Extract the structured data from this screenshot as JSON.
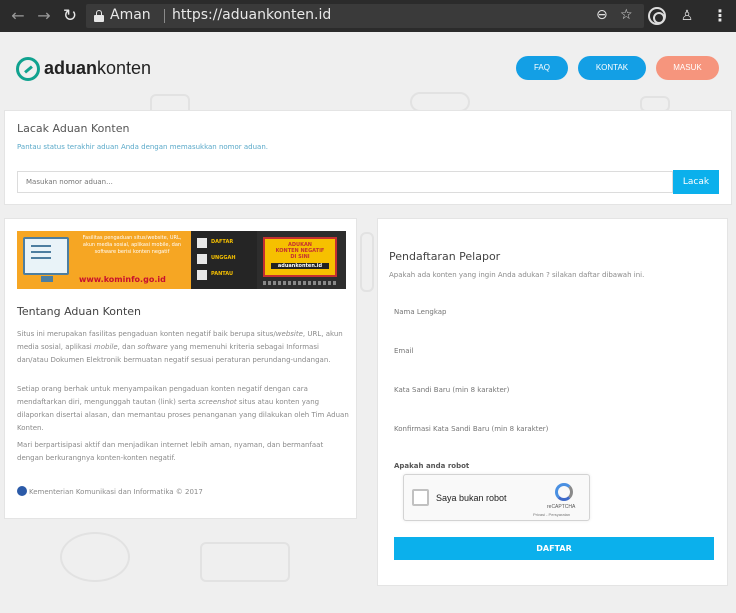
{
  "browser": {
    "secure_label": "Aman",
    "url": "https://aduankonten.id"
  },
  "logo": {
    "part1": "aduan",
    "part2": "konten"
  },
  "nav": {
    "faq": "FAQ",
    "kontak": "KONTAK",
    "masuk": "MASUK"
  },
  "lacak": {
    "title": "Lacak Aduan Konten",
    "subtitle": "Pantau status terakhir aduan Anda dengan memasukkan nomor aduan.",
    "placeholder": "Masukan nomor aduan...",
    "button": "Lacak"
  },
  "banner": {
    "facility": "Fasilitas pengaduan situs/website, URL, akun media sosial, aplikasi mobile, dan software berisi konten negatif",
    "url": "www.kominfo.go.id",
    "steps": [
      "DAFTAR",
      "UNGGAH",
      "PANTAU"
    ],
    "cta_line1": "ADUKAN",
    "cta_line2": "KONTEN NEGATIF",
    "cta_line3": "DI SINI",
    "cta_url": "aduankonten.id"
  },
  "tentang": {
    "title": "Tentang Aduan Konten",
    "p1_a": "Situs ini merupakan fasilitas pengaduan konten negatif baik berupa situs/",
    "p1_b": "website",
    "p1_c": ", URL, akun media sosial, aplikasi ",
    "p1_d": "mobile",
    "p1_e": ", dan ",
    "p1_f": "software",
    "p1_g": " yang memenuhi kriteria sebagai Informasi dan/atau Dokumen Elektronik bermuatan negatif sesuai peraturan perundang-undangan.",
    "p2_a": "Setiap orang berhak untuk menyampaikan pengaduan konten negatif dengan cara mendaftarkan diri, mengunggah tautan (link) serta ",
    "p2_b": "screenshot",
    "p2_c": " situs atau konten yang dilaporkan disertai alasan, dan memantau proses penanganan yang dilakukan oleh Tim Aduan Konten.",
    "p3": "Mari berpartisipasi aktif dan menjadikan internet lebih aman, nyaman, dan bermanfaat dengan berkurangnya konten-konten negatif.",
    "footer": "Kementerian Komunikasi dan Informatika © 2017"
  },
  "register": {
    "title": "Pendaftaran Pelapor",
    "subtitle": "Apakah ada konten yang ingin Anda adukan ? silakan daftar dibawah ini.",
    "name_placeholder": "Nama Lengkap",
    "email_placeholder": "Email",
    "password_placeholder": "Kata Sandi Baru (min 8 karakter)",
    "confirm_placeholder": "Konfirmasi Kata Sandi Baru (min 8 karakter)",
    "robot_label": "Apakah anda robot",
    "captcha_label": "Saya bukan robot",
    "captcha_brand": "reCAPTCHA",
    "captcha_links": "Privasi - Persyaratan",
    "submit": "DAFTAR"
  }
}
